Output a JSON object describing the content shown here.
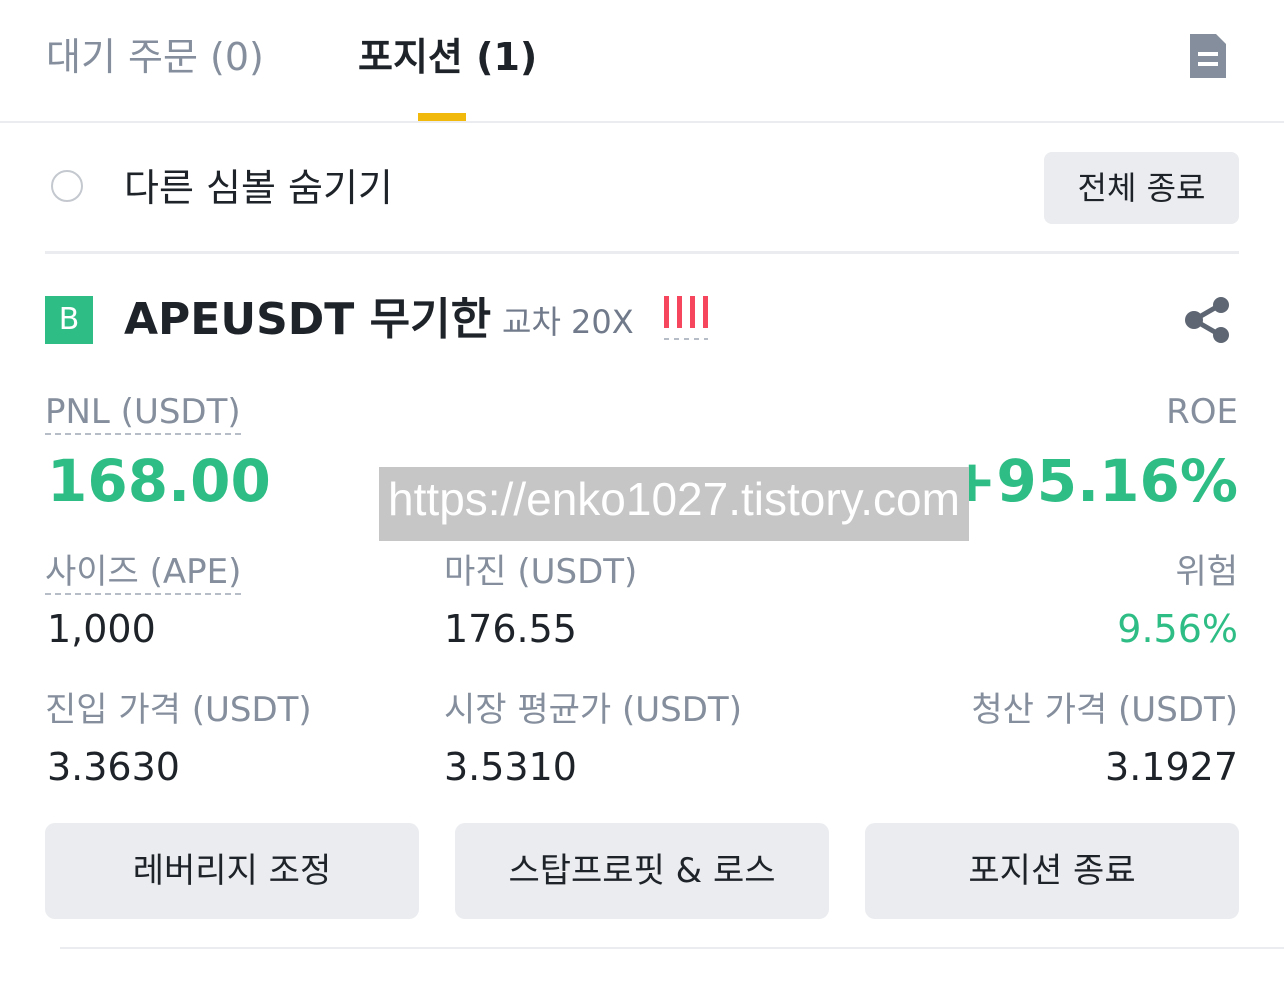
{
  "tabs": {
    "pending_orders": "대기 주문 (0)",
    "positions": "포지션 (1)",
    "active": "positions",
    "document_icon": "document-icon"
  },
  "filter": {
    "hide_other_symbols": "다른 심볼 숨기기",
    "close_all_button": "전체 종료"
  },
  "position": {
    "side_badge": "B",
    "symbol": "APEUSDT 무기한",
    "margin_mode": "교차 20X",
    "risk_bars_icon": "risk-level-bars-icon",
    "share_icon": "share-icon",
    "pnl_label": "PNL (USDT)",
    "pnl_value": "168.00",
    "roe_label": "ROE",
    "roe_value": "+95.16%",
    "size_label": "사이즈 (APE)",
    "size_value": "1,000",
    "margin_label": "마진 (USDT)",
    "margin_value": "176.55",
    "risk_label": "위험",
    "risk_value": "9.56%",
    "entry_price_label": "진입 가격 (USDT)",
    "entry_price_value": "3.3630",
    "mark_price_label": "시장 평균가 (USDT)",
    "mark_price_value": "3.5310",
    "liq_price_label": "청산 가격 (USDT)",
    "liq_price_value": "3.1927"
  },
  "actions": {
    "adjust_leverage": "레버리지 조정",
    "tp_sl": "스탑프로핏 & 로스",
    "close_position": "포지션 종료"
  },
  "watermark": "https://enko1027.tistory.com",
  "colors": {
    "accent": "#f0b90b",
    "profit": "#2ebd85",
    "risk_bars": "#f6465d",
    "muted_text": "#848e9c",
    "button_bg": "#eaecef"
  }
}
